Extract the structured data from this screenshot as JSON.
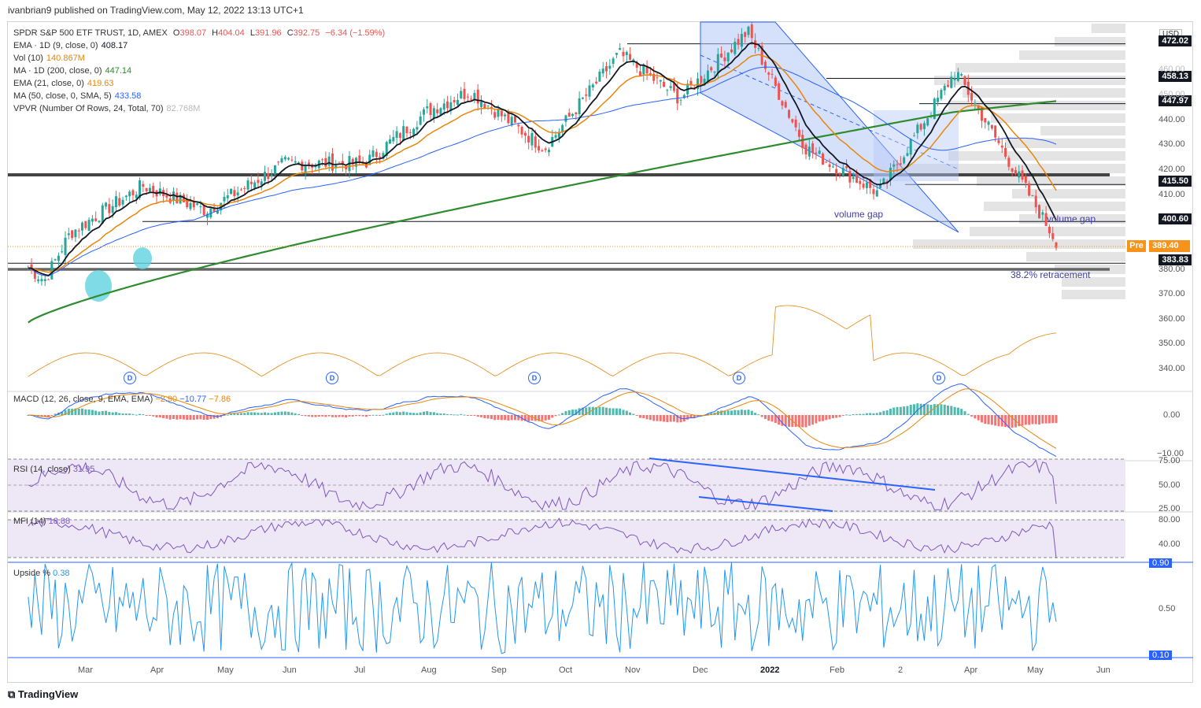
{
  "header": "ivanbrian9 published on TradingView.com, May 12, 2022 13:13 UTC+1",
  "symbol_line": {
    "name": "SPDR S&P 500 ETF TRUST, 1D, AMEX",
    "o_label": "O",
    "o": "398.07",
    "h_label": "H",
    "h": "404.04",
    "l_label": "L",
    "l": "391.96",
    "c_label": "C",
    "c": "392.75",
    "chg": "−6.34 (−1.59%)"
  },
  "legends": [
    {
      "label": "EMA · 1D (9, close, 0)",
      "value": "408.17",
      "color": "#131722"
    },
    {
      "label": "Vol (10)",
      "value": "140.867M",
      "color": "#e8860c"
    },
    {
      "label": "MA · 1D (200, close, 0)",
      "value": "447.14",
      "color": "#2e8b2e"
    },
    {
      "label": "EMA (21, close, 0)",
      "value": "419.63",
      "color": "#e8860c"
    },
    {
      "label": "MA (50, close, 0, SMA, 5)",
      "value": "433.58",
      "color": "#2962ff"
    },
    {
      "label": "VPVR (Number Of Rows, 24, Total, 70)",
      "value": "82.768M",
      "color": "#c9c9c9"
    }
  ],
  "panes": {
    "macd": {
      "label": "MACD (12, 26, close, 9, EMA, EMA)",
      "v1": "−2.90",
      "v2": "−10.77",
      "v3": "−7.86"
    },
    "rsi": {
      "label": "RSI (14, close)",
      "value": "31.95"
    },
    "mfi": {
      "label": "MFI (14)",
      "value": "18.88"
    },
    "upside": {
      "label": "Upside %",
      "value": "0.38"
    }
  },
  "price_tags": [
    {
      "text": "472.02"
    },
    {
      "text": "458.13"
    },
    {
      "text": "447.97"
    },
    {
      "text": "415.50"
    },
    {
      "text": "400.60"
    },
    {
      "text": "383.83"
    }
  ],
  "pre": {
    "label": "Pre",
    "value": "389.40"
  },
  "currency": "USD",
  "y_ticks": [
    "440.00",
    "430.00",
    "420.00",
    "410.00",
    "380.00",
    "370.00",
    "360.00",
    "350.00",
    "340.00"
  ],
  "y_ticks_hidden": [
    "460.00",
    "450.00"
  ],
  "macd_ticks": [
    "0.00",
    "−10.00"
  ],
  "rsi_ticks": [
    "75.00",
    "50.00",
    "25.00"
  ],
  "mfi_ticks": [
    "80.00",
    "40.00"
  ],
  "upside_ticks": [
    "0.90",
    "0.50",
    "0.10"
  ],
  "x_labels": [
    "Mar",
    "Apr",
    "May",
    "Jun",
    "Jul",
    "Aug",
    "Sep",
    "Oct",
    "Nov",
    "Dec",
    "2022",
    "Feb",
    "2",
    "Apr",
    "May",
    "Jun"
  ],
  "annotations": {
    "gap1": "volume gap",
    "gap2": "volume gap",
    "retracement": "38.2% retracement"
  },
  "dividend_marker": "D",
  "footer": "TradingView",
  "colors": {
    "up": "#26a69a",
    "down": "#ef5350",
    "ema9": "#131722",
    "ema21": "#e8860c",
    "sma50": "#2962ff",
    "ma200": "#2e8b2e",
    "channel": "#b3c7f7",
    "rsi": "#7e57c2"
  },
  "chart_data": {
    "type": "candlestick",
    "title": "SPDR S&P 500 ETF TRUST, 1D, AMEX",
    "x_range": [
      "Feb 2021",
      "Jun 2022"
    ],
    "ylim": [
      335,
      475
    ],
    "anchor_prices": [
      {
        "date": "2021-02-25",
        "close": 382
      },
      {
        "date": "2021-03-04",
        "close": 377
      },
      {
        "date": "2021-03-15",
        "close": 396
      },
      {
        "date": "2021-04-15",
        "close": 415
      },
      {
        "date": "2021-05-12",
        "close": 405
      },
      {
        "date": "2021-06-15",
        "close": 424
      },
      {
        "date": "2021-07-19",
        "close": 424
      },
      {
        "date": "2021-08-15",
        "close": 445
      },
      {
        "date": "2021-09-02",
        "close": 453
      },
      {
        "date": "2021-10-04",
        "close": 430
      },
      {
        "date": "2021-11-05",
        "close": 468
      },
      {
        "date": "2021-12-01",
        "close": 450
      },
      {
        "date": "2021-12-30",
        "close": 477
      },
      {
        "date": "2022-01-24",
        "close": 430
      },
      {
        "date": "2022-02-24",
        "close": 412
      },
      {
        "date": "2022-03-29",
        "close": 461
      },
      {
        "date": "2022-04-29",
        "close": 412
      },
      {
        "date": "2022-05-11",
        "close": 392.75
      }
    ],
    "ema9_last": 408.17,
    "ema21_last": 419.63,
    "sma50_last": 433.58,
    "ma200_last": 447.14,
    "horizontal_levels": [
      472.02,
      458.13,
      447.97,
      415.5,
      400.6,
      383.83,
      380
    ],
    "rsi_last": 31.95,
    "mfi_last": 18.88,
    "upside_last": 0.38,
    "macd": {
      "macd": -2.9,
      "signal": -10.77,
      "hist": -7.86
    }
  }
}
